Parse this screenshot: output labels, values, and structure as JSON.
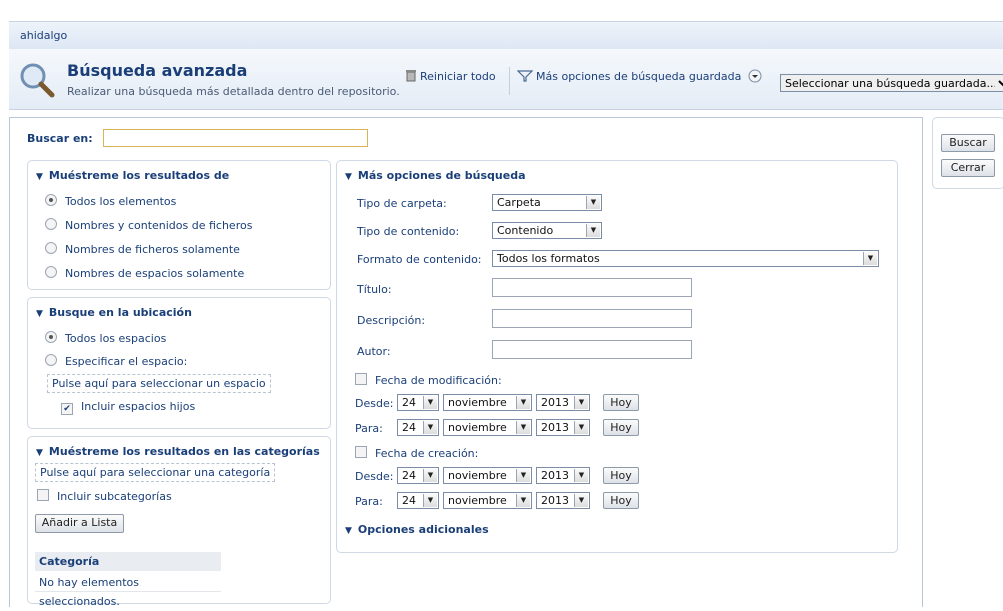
{
  "user": "ahidalgo",
  "header": {
    "title": "Búsqueda avanzada",
    "subtitle": "Realizar una búsqueda más detallada dentro del repositorio.",
    "reset_label": "Reiniciar todo",
    "more_saved_label": "Más opciones de búsqueda guardada",
    "saved_select_value": "Seleccionar una búsqueda guardada..."
  },
  "search": {
    "label": "Buscar en:",
    "value": ""
  },
  "results_box": {
    "title": "Muéstreme los resultados de",
    "options": [
      {
        "label": "Todos los elementos",
        "selected": true
      },
      {
        "label": "Nombres y contenidos de ficheros",
        "selected": false
      },
      {
        "label": "Nombres de ficheros solamente",
        "selected": false
      },
      {
        "label": "Nombres de espacios solamente",
        "selected": false
      }
    ]
  },
  "location_box": {
    "title": "Busque en la ubicación",
    "options": [
      {
        "label": "Todos los espacios",
        "selected": true
      },
      {
        "label": "Especificar el espacio:",
        "selected": false
      }
    ],
    "select_space_link": "Pulse aquí para seleccionar un espacio",
    "include_children_label": "Incluir espacios hijos",
    "include_children_checked": true
  },
  "categories_box": {
    "title": "Muéstreme los resultados en las categorías",
    "select_category_link": "Pulse aquí para seleccionar una categoría",
    "include_sub_label": "Incluir subcategorías",
    "add_button": "Añadir a Lista",
    "table_header": "Categoría",
    "empty_text": "No hay elementos seleccionados."
  },
  "more_options": {
    "title": "Más opciones de búsqueda",
    "folder_type_label": "Tipo de carpeta:",
    "folder_type_value": "Carpeta",
    "content_type_label": "Tipo de contenido:",
    "content_type_value": "Contenido",
    "format_label": "Formato de contenido:",
    "format_value": "Todos los formatos",
    "title_label": "Título:",
    "description_label": "Descripción:",
    "author_label": "Autor:",
    "modified_label": "Fecha de modificación:",
    "created_label": "Fecha de creación:",
    "from_label": "Desde:",
    "to_label": "Para:",
    "day": "24",
    "month": "noviembre",
    "year": "2013",
    "today_button": "Hoy",
    "additional_label": "Opciones adicionales"
  },
  "actions": {
    "search_button": "Buscar",
    "close_button": "Cerrar"
  }
}
